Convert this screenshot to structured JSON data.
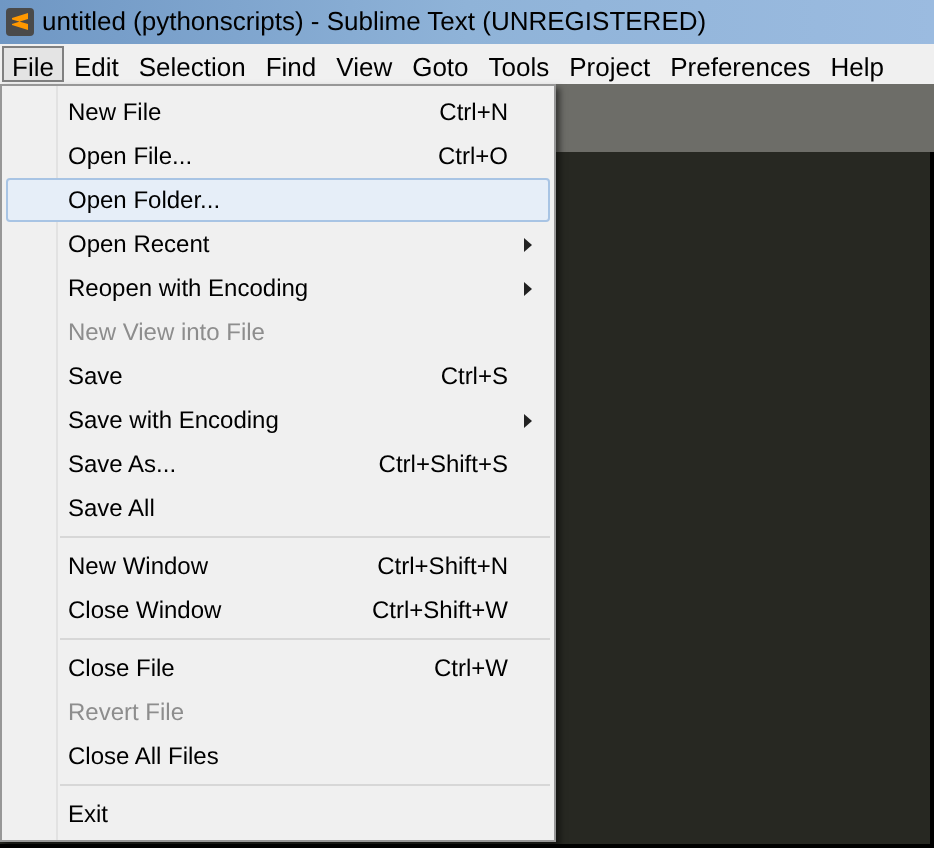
{
  "window": {
    "title": "untitled (pythonscripts) - Sublime Text (UNREGISTERED)"
  },
  "menubar": [
    {
      "label": "File",
      "selected": true
    },
    {
      "label": "Edit",
      "selected": false
    },
    {
      "label": "Selection",
      "selected": false
    },
    {
      "label": "Find",
      "selected": false
    },
    {
      "label": "View",
      "selected": false
    },
    {
      "label": "Goto",
      "selected": false
    },
    {
      "label": "Tools",
      "selected": false
    },
    {
      "label": "Project",
      "selected": false
    },
    {
      "label": "Preferences",
      "selected": false
    },
    {
      "label": "Help",
      "selected": false
    }
  ],
  "file_menu": [
    [
      {
        "label": "New File",
        "shortcut": "Ctrl+N",
        "submenu": false,
        "disabled": false,
        "selected": false
      },
      {
        "label": "Open File...",
        "shortcut": "Ctrl+O",
        "submenu": false,
        "disabled": false,
        "selected": false
      },
      {
        "label": "Open Folder...",
        "submenu": false,
        "disabled": false,
        "selected": true
      },
      {
        "label": "Open Recent",
        "submenu": true,
        "disabled": false,
        "selected": false
      },
      {
        "label": "Reopen with Encoding",
        "submenu": true,
        "disabled": false,
        "selected": false
      },
      {
        "label": "New View into File",
        "submenu": false,
        "disabled": true,
        "selected": false
      },
      {
        "label": "Save",
        "shortcut": "Ctrl+S",
        "submenu": false,
        "disabled": false,
        "selected": false
      },
      {
        "label": "Save with Encoding",
        "submenu": true,
        "disabled": false,
        "selected": false
      },
      {
        "label": "Save As...",
        "shortcut": "Ctrl+Shift+S",
        "submenu": false,
        "disabled": false,
        "selected": false
      },
      {
        "label": "Save All",
        "submenu": false,
        "disabled": false,
        "selected": false
      }
    ],
    [
      {
        "label": "New Window",
        "shortcut": "Ctrl+Shift+N",
        "submenu": false,
        "disabled": false,
        "selected": false
      },
      {
        "label": "Close Window",
        "shortcut": "Ctrl+Shift+W",
        "submenu": false,
        "disabled": false,
        "selected": false
      }
    ],
    [
      {
        "label": "Close File",
        "shortcut": "Ctrl+W",
        "submenu": false,
        "disabled": false,
        "selected": false
      },
      {
        "label": "Revert File",
        "submenu": false,
        "disabled": true,
        "selected": false
      },
      {
        "label": "Close All Files",
        "submenu": false,
        "disabled": false,
        "selected": false
      }
    ],
    [
      {
        "label": "Exit",
        "submenu": false,
        "disabled": false,
        "selected": false
      }
    ]
  ]
}
